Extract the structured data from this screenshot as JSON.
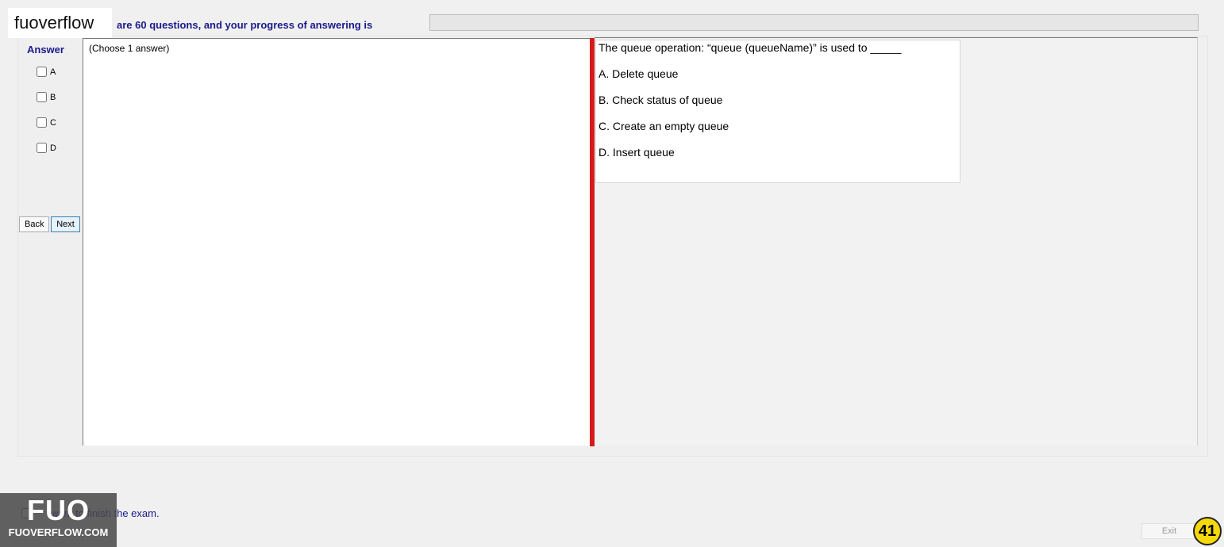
{
  "brand_tag": "fuoverflow",
  "progress": {
    "text": "are 60 questions, and your progress of answering is",
    "fraction": 0
  },
  "answer_panel": {
    "heading": "Answer",
    "options": [
      "A",
      "B",
      "C",
      "D"
    ],
    "back_label": "Back",
    "next_label": "Next"
  },
  "left_pane": {
    "hint": "(Choose 1 answer)"
  },
  "question": {
    "text": "The queue operation: “queue (queueName)” is used to _____",
    "options": [
      "A.  Delete queue",
      "B.  Check status of queue",
      "C.  Create an empty queue",
      "D.  Insert queue"
    ]
  },
  "footer": {
    "finish_text": "want to finish the exam.",
    "exit_label": "Exit",
    "page_number": "41"
  },
  "logo": {
    "big": "FUO",
    "small": "FUOVERFLOW.COM"
  },
  "watermark_text": "FUOVERFLOW.COM",
  "colors": {
    "heading_blue": "#1a1a8c",
    "splitter_red": "#d71a1a",
    "badge_yellow": "#f5d90a"
  }
}
